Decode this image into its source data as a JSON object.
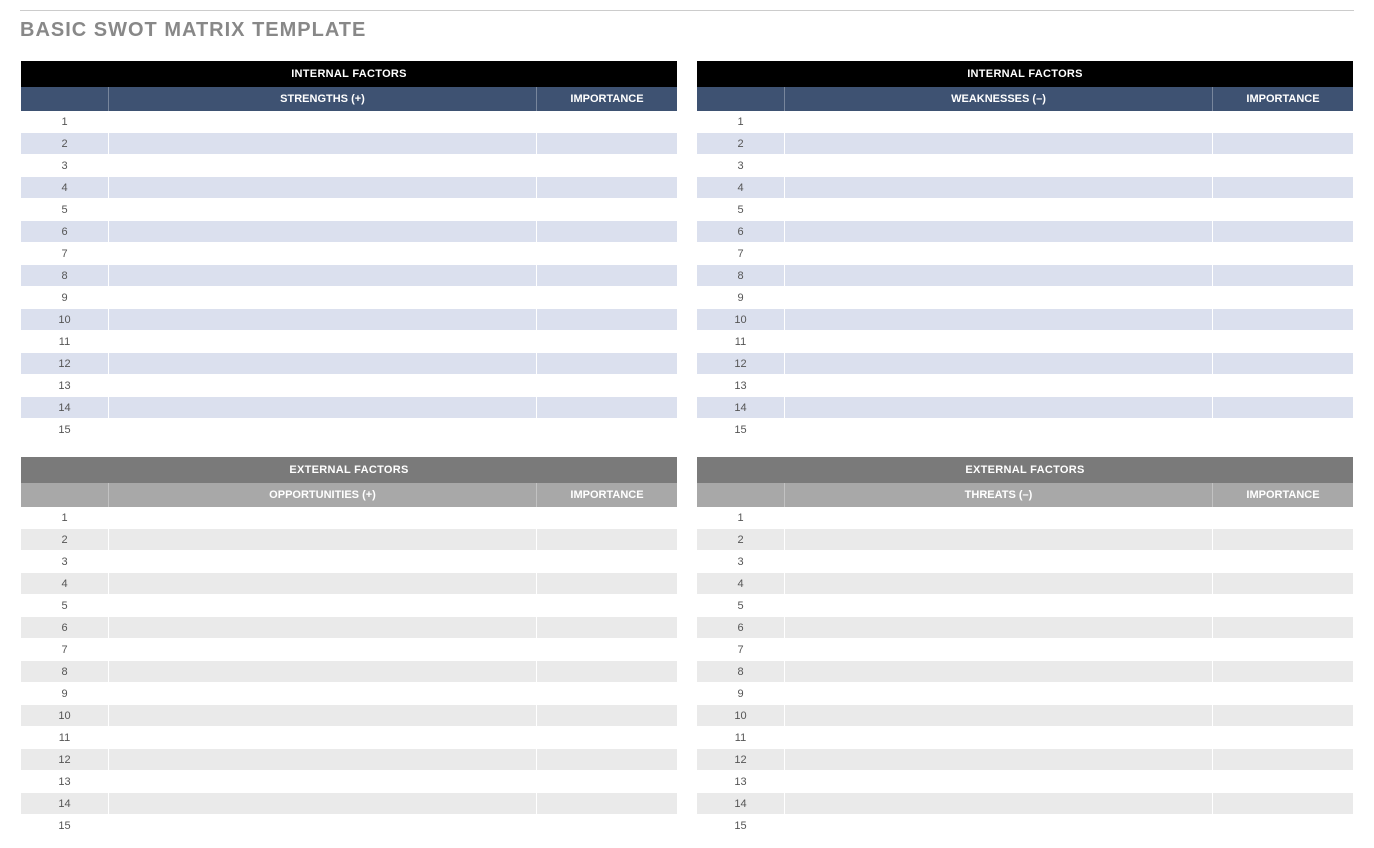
{
  "title": "BASIC SWOT MATRIX TEMPLATE",
  "row_count": 15,
  "panels": {
    "strengths": {
      "section_header": "INTERNAL FACTORS",
      "subheader_desc": "STRENGTHS (+)",
      "subheader_importance": "IMPORTANCE"
    },
    "weaknesses": {
      "section_header": "INTERNAL FACTORS",
      "subheader_desc": "WEAKNESSES (–)",
      "subheader_importance": "IMPORTANCE"
    },
    "opportunities": {
      "section_header": "EXTERNAL FACTORS",
      "subheader_desc": "OPPORTUNITIES (+)",
      "subheader_importance": "IMPORTANCE"
    },
    "threats": {
      "section_header": "EXTERNAL FACTORS",
      "subheader_desc": "THREATS (–)",
      "subheader_importance": "IMPORTANCE"
    }
  }
}
